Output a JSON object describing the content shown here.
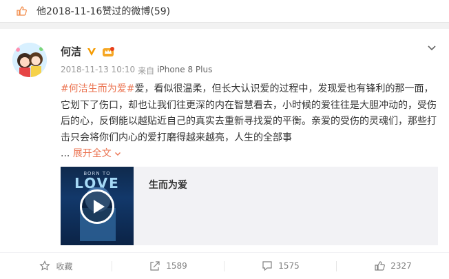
{
  "topbar": {
    "icon": "thumbs-up-icon",
    "text": "他2018-11-16赞过的微博(59)"
  },
  "post": {
    "author": {
      "name": "何洁",
      "verified_icon": "verified-v-icon",
      "member_icon": "member-crown-icon"
    },
    "meta": {
      "time": "2018-11-13 10:10",
      "source_prefix": "来自",
      "device": "iPhone 8 Plus"
    },
    "text": {
      "hashtag": "#何洁生而为爱#",
      "body": "爱，看似很温柔，但长大认识爱的过程中，发现爱也有锋利的那一面，它划下了伤口，却也让我们往更深的内在智慧看去，小时候的爱往往是大胆冲动的，受伤后的心，反倒能以越贴近自己的真实去重新寻找爱的平衡。亲爱的受伤的灵魂们，那些打击只会将你们内心的爱打磨得越来越亮，人生的全部事",
      "ellipsis": "...",
      "expand_label": "展开全文",
      "expand_icon": "chevron-down-icon"
    },
    "media": {
      "thumb_label_top": "BORN TO",
      "thumb_label_love": "LOVE",
      "play_icon": "play-icon",
      "title": "生而为爱"
    },
    "actions": [
      {
        "label": "收藏",
        "icon": "star-icon"
      },
      {
        "label": "1589",
        "icon": "share-icon"
      },
      {
        "label": "1575",
        "icon": "comment-icon"
      },
      {
        "label": "2327",
        "icon": "thumbs-up-icon"
      }
    ]
  },
  "colors": {
    "accent": "#eb7350",
    "text": "#333333",
    "muted": "#999999",
    "background": "#f2f2f2",
    "verified_orange": "#f59b00"
  }
}
